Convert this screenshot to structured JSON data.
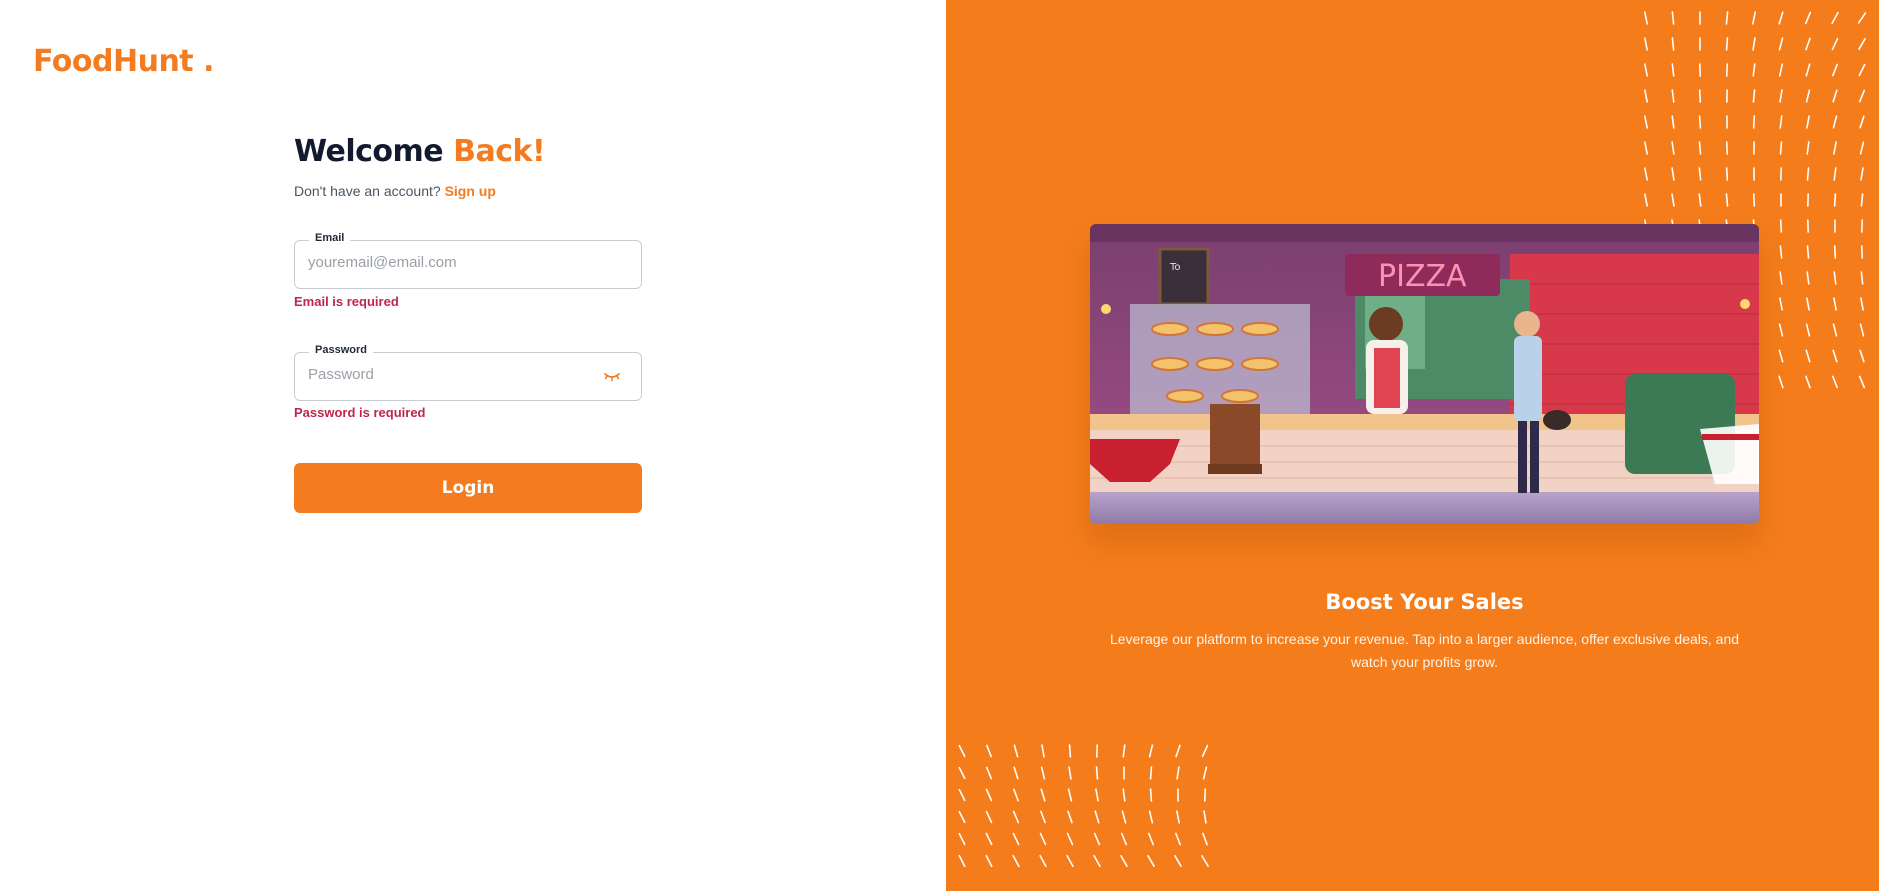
{
  "brand": {
    "name": "FoodHunt",
    "dot": ".",
    "color": "#f47b20"
  },
  "login": {
    "title_main": "Welcome",
    "title_accent": "Back!",
    "signup_prompt": "Don't have an account?",
    "signup_link": "Sign up",
    "email": {
      "label": "Email",
      "placeholder": "youremail@email.com",
      "value": "",
      "error": "Email is required"
    },
    "password": {
      "label": "Password",
      "placeholder": "Password",
      "value": "",
      "error": "Password is required",
      "toggle_icon": "eye-closed-icon"
    },
    "submit_label": "Login"
  },
  "promo": {
    "heading": "Boost Your Sales",
    "description": "Leverage our platform to increase your revenue. Tap into a larger audience, offer exclusive deals, and watch your profits grow.",
    "illustration_sign": "PIZZA",
    "background_color": "#f47c1a"
  },
  "colors": {
    "accent": "#f47b20",
    "error": "#c0264b",
    "heading": "#111a2e"
  }
}
